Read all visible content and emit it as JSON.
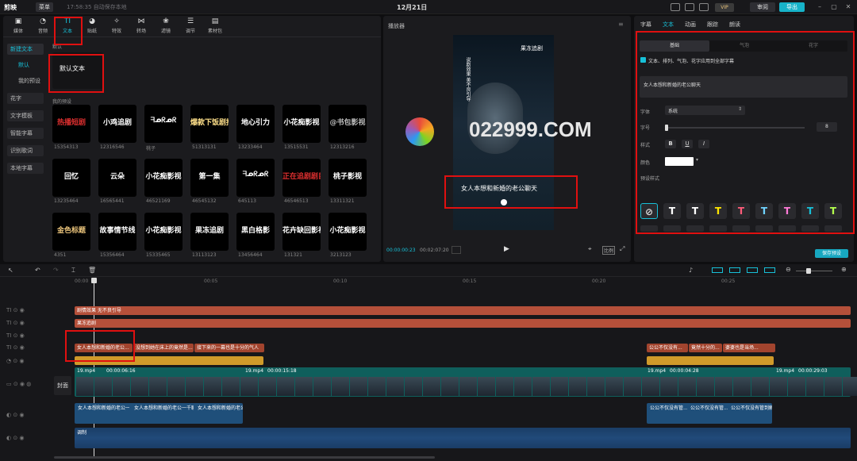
{
  "titlebar": {
    "app_name": "剪映",
    "menu_label": "菜单",
    "autosave": "17:58:35 自动保存本地",
    "date": "12月21日",
    "vip_label": "VIP",
    "share_label": "审阅",
    "export_label": "导出"
  },
  "toolbar": {
    "tabs": [
      {
        "label": "媒体",
        "icon": "media-icon"
      },
      {
        "label": "音频",
        "icon": "audio-icon"
      },
      {
        "label": "文本",
        "icon": "text-icon"
      },
      {
        "label": "贴纸",
        "icon": "sticker-icon"
      },
      {
        "label": "特效",
        "icon": "effects-icon"
      },
      {
        "label": "转场",
        "icon": "transition-icon"
      },
      {
        "label": "滤镜",
        "icon": "filter-icon"
      },
      {
        "label": "调节",
        "icon": "adjust-icon"
      },
      {
        "label": "素材包",
        "icon": "package-icon"
      }
    ]
  },
  "leftnav": {
    "items": [
      "新建文本",
      "默认",
      "我的预设",
      "花字",
      "文字模板",
      "智能字幕",
      "识别歌词",
      "本地字幕"
    ]
  },
  "library": {
    "default_section": "默认",
    "default_card": "默认文本",
    "preset_section": "我的预设",
    "cards": [
      {
        "text": "热播短剧",
        "cap": "15354313",
        "color": "#e03030"
      },
      {
        "text": "小鸡追剧",
        "cap": "12316546",
        "color": "#ffffff"
      },
      {
        "text": "ᖷᓄᖇᓄᖇ",
        "cap": "桃子",
        "color": "#ffffff"
      },
      {
        "text": "爆款下饭剧推荐",
        "cap": "51313131",
        "color": "#ffe08a"
      },
      {
        "text": "地心引力",
        "cap": "13233464",
        "color": "#ffffff"
      },
      {
        "text": "小花痴影视",
        "cap": "13515531",
        "color": "#ffffff"
      },
      {
        "text": "@书包影视",
        "cap": "12313216",
        "color": "#bbbbbb"
      },
      {
        "text": "回忆",
        "cap": "13235464",
        "color": "#ffffff"
      },
      {
        "text": "云朵",
        "cap": "16565441",
        "color": "#ffffff"
      },
      {
        "text": "小花痴影视",
        "cap": "46521169",
        "color": "#ffffff"
      },
      {
        "text": "第一集",
        "cap": "46545132",
        "color": "#ffffff"
      },
      {
        "text": "ᖷᓄᖇᓄᖇ",
        "cap": "645113",
        "color": "#ffffff"
      },
      {
        "text": "正在追剧剧目",
        "cap": "46546513",
        "color": "#e03030"
      },
      {
        "text": "桃子影视",
        "cap": "13311321",
        "color": "#ffffff"
      },
      {
        "text": "金色标题",
        "cap": "4351",
        "color": "#e8c27a"
      },
      {
        "text": "故事情节线",
        "cap": "15356464",
        "color": "#ffffff"
      },
      {
        "text": "小花痴影视",
        "cap": "15335465",
        "color": "#ffffff"
      },
      {
        "text": "果冻追剧",
        "cap": "13113123",
        "color": "#ffffff"
      },
      {
        "text": "黑白格影",
        "cap": "13456464",
        "color": "#ffffff"
      },
      {
        "text": "花卉缺回影视",
        "cap": "131321",
        "color": "#ffffff"
      },
      {
        "text": "小花痴影视",
        "cap": "3213123",
        "color": "#ffffff"
      }
    ]
  },
  "player": {
    "title": "播放器",
    "video_top_text": "果冻追剧",
    "video_side_text": "说剧效果 美不良引导",
    "subtitle": "女人本想和新婚的老公聊天",
    "time_current": "00:00:00:23",
    "time_total": "00:02:07:20",
    "watermark": "022999.COM"
  },
  "props": {
    "tabs": [
      "字幕",
      "文本",
      "动画",
      "跟踪",
      "朗读"
    ],
    "subtabs": [
      "基础",
      "气泡",
      "花字"
    ],
    "apply_all": "文本、排列、气泡、花字应用到全部字幕",
    "text_value": "女人本想和新婚的老公聊天",
    "font_label": "字体",
    "font_value": "系统",
    "size_label": "字号",
    "size_value": "8",
    "style_label": "样式",
    "style_buttons": [
      "B",
      "U",
      "I"
    ],
    "color_label": "颜色",
    "preset_label": "预设样式",
    "save_preset": "保存预设"
  },
  "timeline": {
    "ticks": [
      "00:00",
      "00:05",
      "00:10",
      "00:15",
      "00:20",
      "00:25"
    ],
    "tracks": {
      "text1": "剧情效果 无不良引导",
      "text2": "果冻追剧",
      "sub_clips": [
        "女人本想和新婚的老公...",
        "没想到她在床上的竟然是...",
        "接下来的一幕也是十分的气人",
        "公公不仅没有...",
        "竟然十分的...",
        "婆婆也是当场..."
      ],
      "video1_label": "19.mp4",
      "video1_time": "00:00:06:16",
      "video2_label": "19.mp4",
      "video2_time": "00:00:15:18",
      "video3_label": "19.mp4",
      "video3_time": "00:00:04:28",
      "video4_label": "19.mp4",
      "video4_time": "00:00:29:03",
      "cover_label": "封面",
      "audio_clips": [
        "女人本想和新婚的老公一起聊天...",
        "女人本想和新婚的老公一千聊...",
        "女人本想和新婚的老公一起...",
        "公公不仅没有管...",
        "公公不仅没有管...",
        "公公不仅没有管到解..."
      ],
      "bgm_label": "调制"
    }
  },
  "colors": {
    "accent": "#17c0d8",
    "highlight": "#e01010",
    "text_track": "#b5503a",
    "sub_track": "#d09a2a",
    "audio_track": "#1f4f7a"
  }
}
